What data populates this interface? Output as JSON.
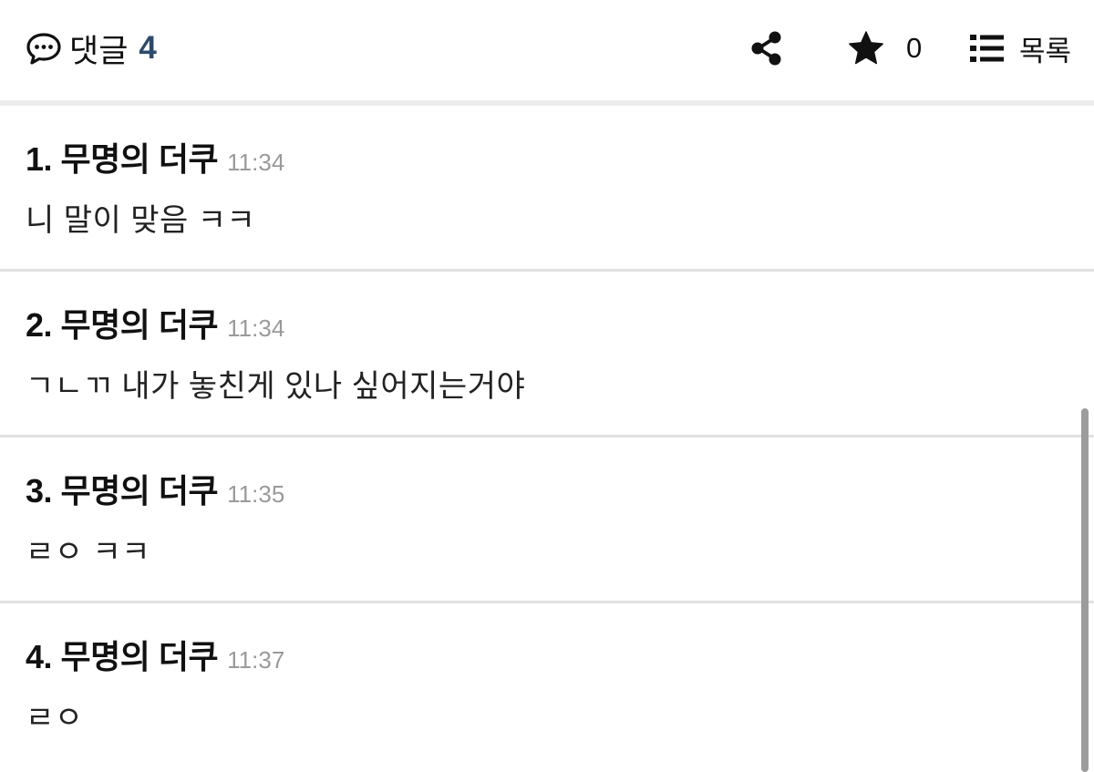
{
  "header": {
    "comments_label": "댓글",
    "comments_count": "4",
    "star_count": "0",
    "list_label": "목록",
    "icons": {
      "comments": "speech-bubble-dots-icon",
      "share": "share-icon",
      "star": "star-icon",
      "list": "list-icon"
    }
  },
  "colors": {
    "count": "#2b4a6e",
    "time": "#9a9a9a",
    "divider": "#e1e1e1"
  },
  "comments": [
    {
      "author": "1. 무명의 더쿠",
      "time": "11:34",
      "text": "니 말이 맞음 ㅋㅋ"
    },
    {
      "author": "2. 무명의 더쿠",
      "time": "11:34",
      "text": "ㄱㄴㄲ 내가 놓친게 있나 싶어지는거야"
    },
    {
      "author": "3. 무명의 더쿠",
      "time": "11:35",
      "text": "ㄹㅇ ㅋㅋ"
    },
    {
      "author": "4. 무명의 더쿠",
      "time": "11:37",
      "text": "ㄹㅇ"
    }
  ]
}
